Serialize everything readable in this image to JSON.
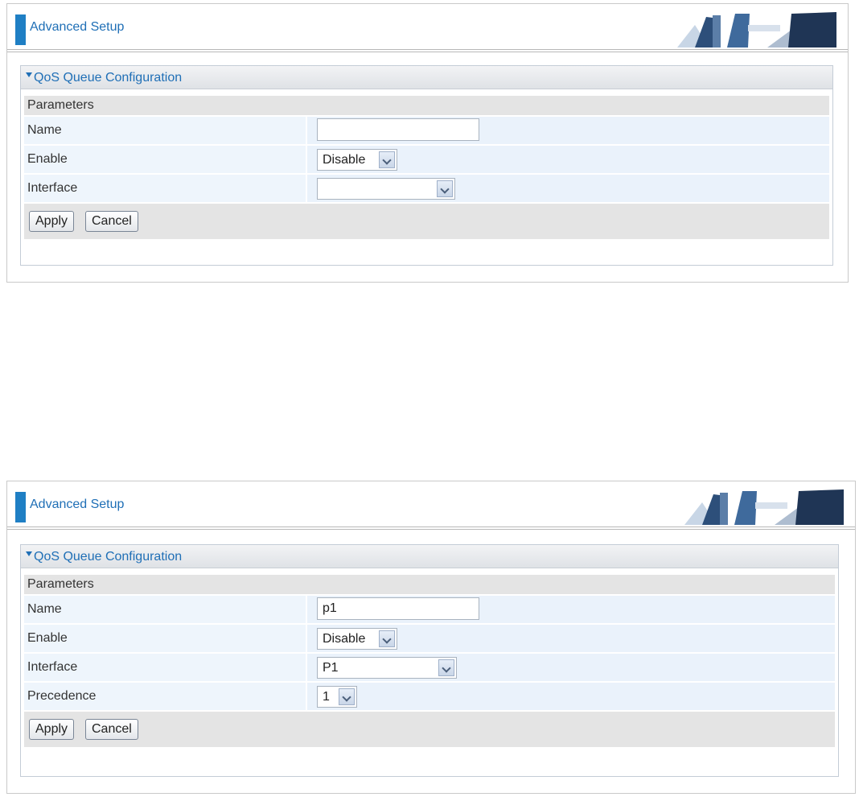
{
  "screens": [
    {
      "banner_title": "Advanced Setup",
      "panel_title": "QoS Queue Configuration",
      "section": "Parameters",
      "fields": {
        "name_label": "Name",
        "name_value": "",
        "enable_label": "Enable",
        "enable_value": "Disable",
        "interface_label": "Interface",
        "interface_value": ""
      },
      "apply_label": "Apply",
      "cancel_label": "Cancel"
    },
    {
      "banner_title": "Advanced Setup",
      "panel_title": "QoS Queue Configuration",
      "section": "Parameters",
      "fields": {
        "name_label": "Name",
        "name_value": "p1",
        "enable_label": "Enable",
        "enable_value": "Disable",
        "interface_label": "Interface",
        "interface_value": "P1",
        "precedence_label": "Precedence",
        "precedence_value": "1"
      },
      "apply_label": "Apply",
      "cancel_label": "Cancel"
    }
  ],
  "colors": {
    "accent": "#1f7fc4",
    "title": "#1f6fb6",
    "row_bg": "#eef5fc",
    "header_bg": "#e4e4e4"
  },
  "icons": {
    "banner_art": "office-chairs-banner-icon",
    "collapse": "triangle-down-icon",
    "select": "chevron-down-icon"
  }
}
